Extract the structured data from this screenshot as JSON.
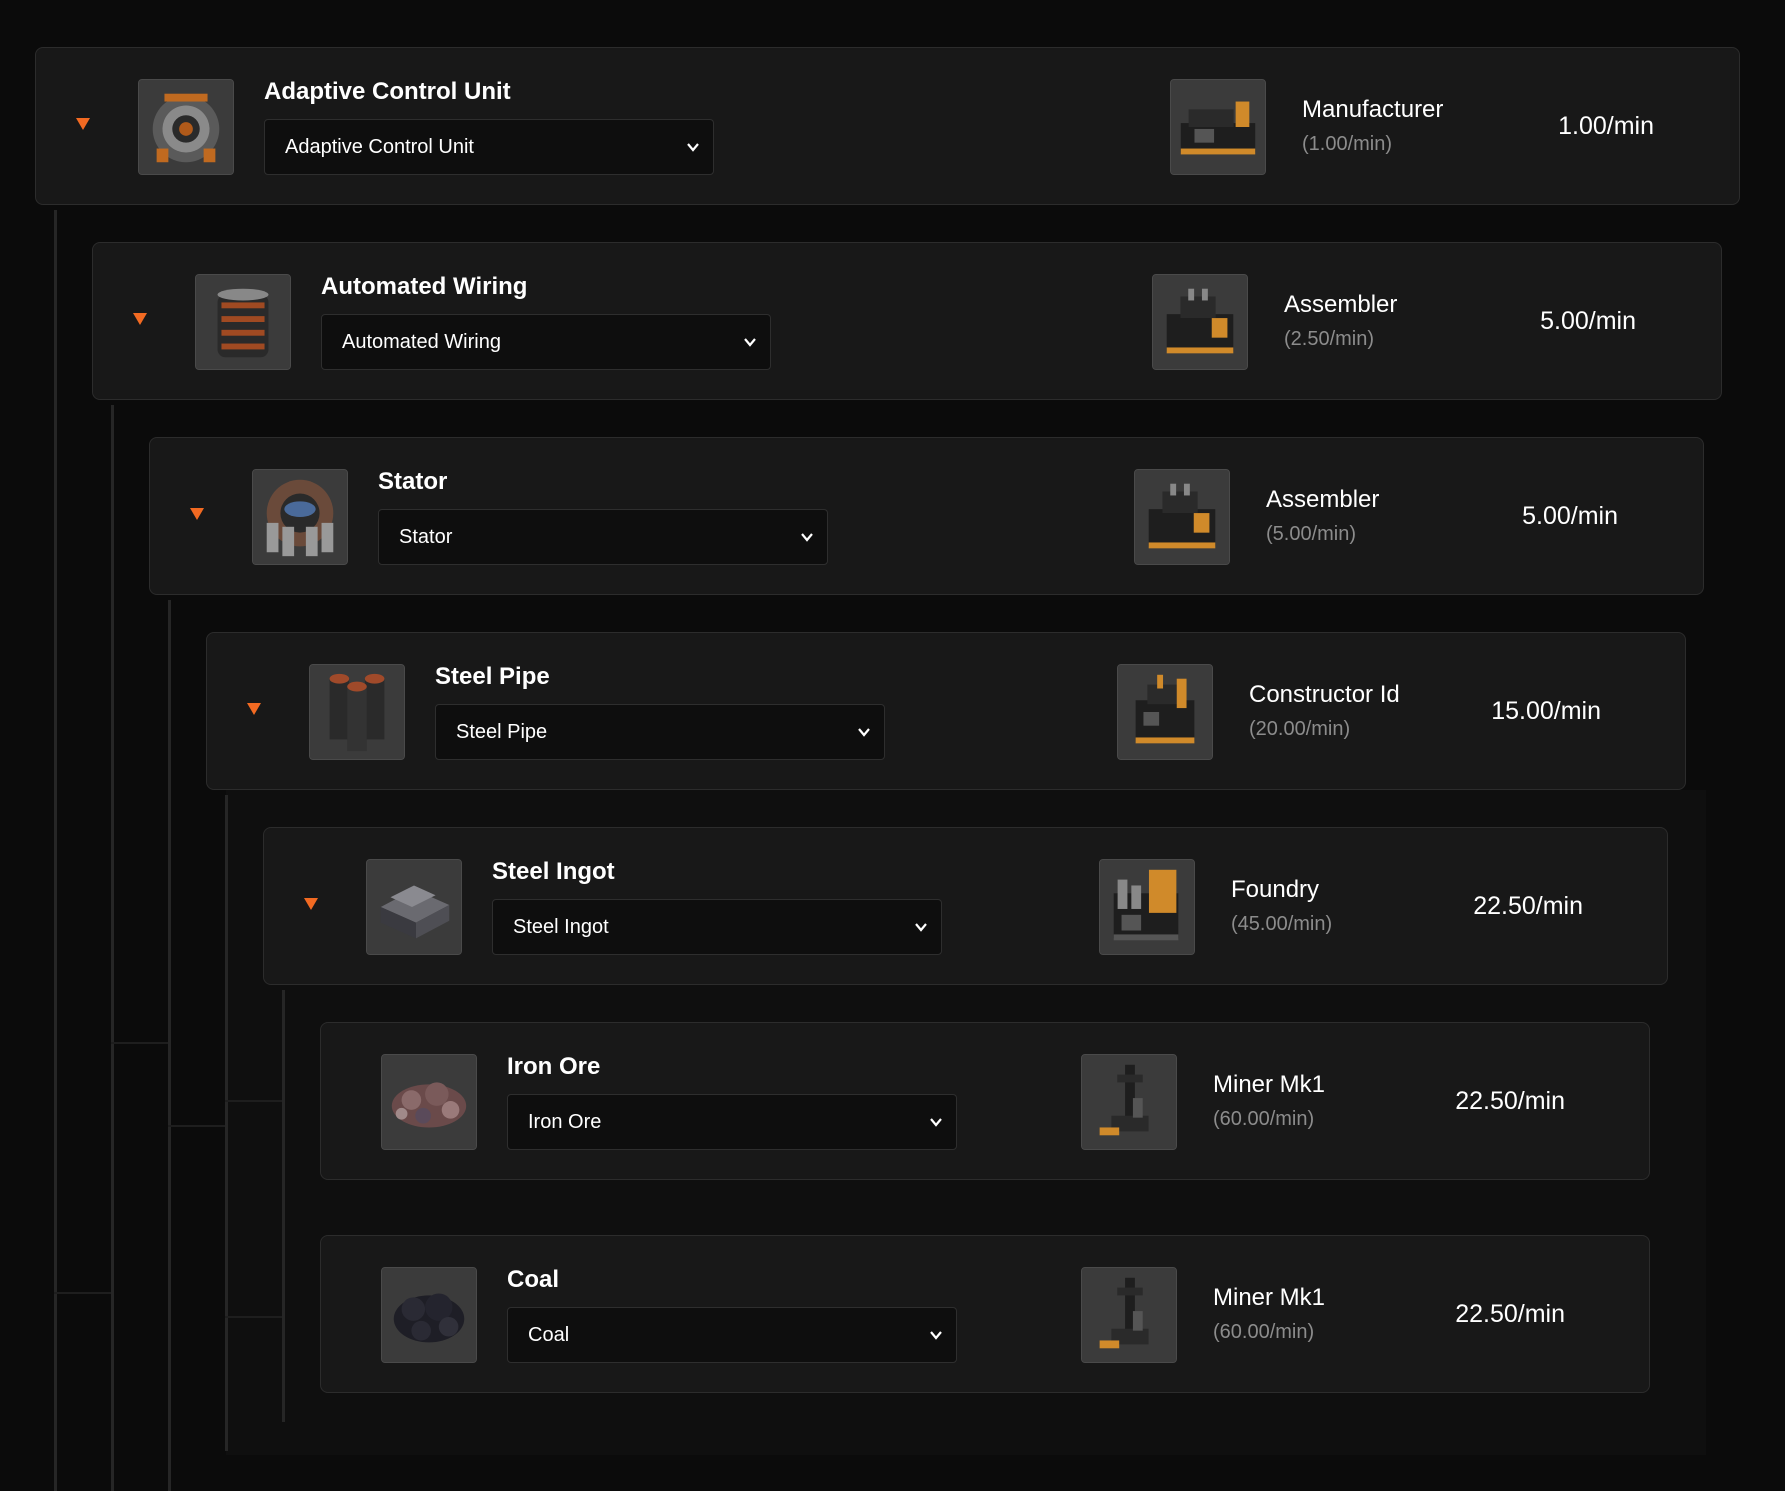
{
  "accent_color": "#f26a22",
  "toggle_icon": "triangle-down",
  "select_icon": "chevron-down",
  "nodes": [
    {
      "title": "Adaptive Control Unit",
      "icon": "adaptive-control-unit",
      "select_value": "Adaptive Control Unit",
      "machine": "Manufacturer",
      "machine_icon": "manufacturer",
      "machine_rate": "(1.00/min)",
      "rate": "1.00/min",
      "expandable": true
    },
    {
      "title": "Automated Wiring",
      "icon": "automated-wiring",
      "select_value": "Automated Wiring",
      "machine": "Assembler",
      "machine_icon": "assembler",
      "machine_rate": "(2.50/min)",
      "rate": "5.00/min",
      "expandable": true
    },
    {
      "title": "Stator",
      "icon": "stator",
      "select_value": "Stator",
      "machine": "Assembler",
      "machine_icon": "assembler",
      "machine_rate": "(5.00/min)",
      "rate": "5.00/min",
      "expandable": true
    },
    {
      "title": "Steel Pipe",
      "icon": "steel-pipe",
      "select_value": "Steel Pipe",
      "machine": "Constructor Id",
      "machine_icon": "constructor",
      "machine_rate": "(20.00/min)",
      "rate": "15.00/min",
      "expandable": true
    },
    {
      "title": "Steel Ingot",
      "icon": "steel-ingot",
      "select_value": "Steel Ingot",
      "machine": "Foundry",
      "machine_icon": "foundry",
      "machine_rate": "(45.00/min)",
      "rate": "22.50/min",
      "expandable": true
    },
    {
      "title": "Iron Ore",
      "icon": "iron-ore",
      "select_value": "Iron Ore",
      "machine": "Miner Mk1",
      "machine_icon": "miner",
      "machine_rate": "(60.00/min)",
      "rate": "22.50/min",
      "expandable": false
    },
    {
      "title": "Coal",
      "icon": "coal",
      "select_value": "Coal",
      "machine": "Miner Mk1",
      "machine_icon": "miner",
      "machine_rate": "(60.00/min)",
      "rate": "22.50/min",
      "expandable": false
    }
  ]
}
